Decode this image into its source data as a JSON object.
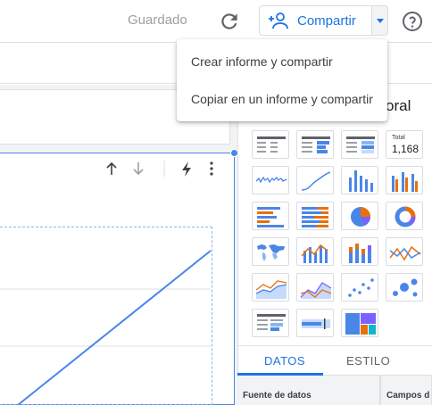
{
  "header": {
    "saved_status": "Guardado",
    "share_label": "Compartir"
  },
  "share_menu": {
    "items": [
      {
        "label": "Crear informe y compartir"
      },
      {
        "label": "Copiar en un informe y compartir"
      }
    ]
  },
  "panel": {
    "title_fragment": "oral",
    "scorecard": {
      "title": "Total",
      "value": "1,168"
    },
    "tabs": [
      {
        "label": "DATOS",
        "active": true
      },
      {
        "label": "ESTILO",
        "active": false
      }
    ],
    "subheaders": [
      "Fuente de datos",
      "Campos d"
    ]
  },
  "chart_tools": {
    "icons": [
      "sort-ascending-icon",
      "sort-descending-icon",
      "bolt-icon",
      "more-vert-icon"
    ]
  },
  "colors": {
    "accent": "#1a73e8",
    "chart_blue": "#4a86e8",
    "chart_orange": "#e8710a",
    "chart_purple": "#7b61ff",
    "chart_teal": "#12b5cb"
  }
}
